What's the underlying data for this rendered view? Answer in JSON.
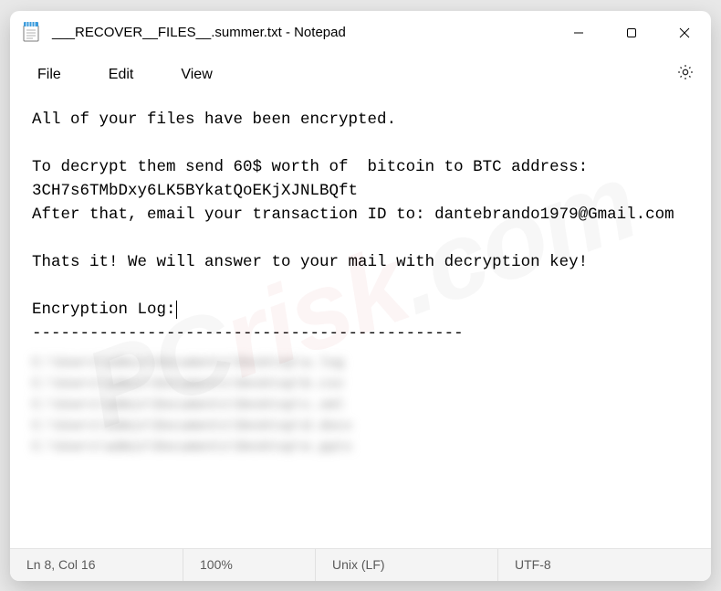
{
  "titlebar": {
    "title": "___RECOVER__FILES__.summer.txt - Notepad"
  },
  "menu": {
    "file": "File",
    "edit": "Edit",
    "view": "View"
  },
  "content": {
    "line1": "All of your files have been encrypted.",
    "line2": "",
    "line3": "To decrypt them send 60$ worth of  bitcoin to BTC address: 3CH7s6TMbDxy6LK5BYkatQoEKjXJNLBQft",
    "line4": "After that, email your transaction ID to: dantebrando1979@Gmail.com",
    "line5": "",
    "line6": "Thats it! We will answer to your mail with decryption key!",
    "line7": "",
    "line8": "Encryption Log:",
    "line9": "---------------------------------------------"
  },
  "status": {
    "position": "Ln 8, Col 16",
    "zoom": "100%",
    "eol": "Unix (LF)",
    "encoding": "UTF-8"
  },
  "watermark": {
    "a": "PC",
    "b": "risk",
    "c": ".com"
  }
}
